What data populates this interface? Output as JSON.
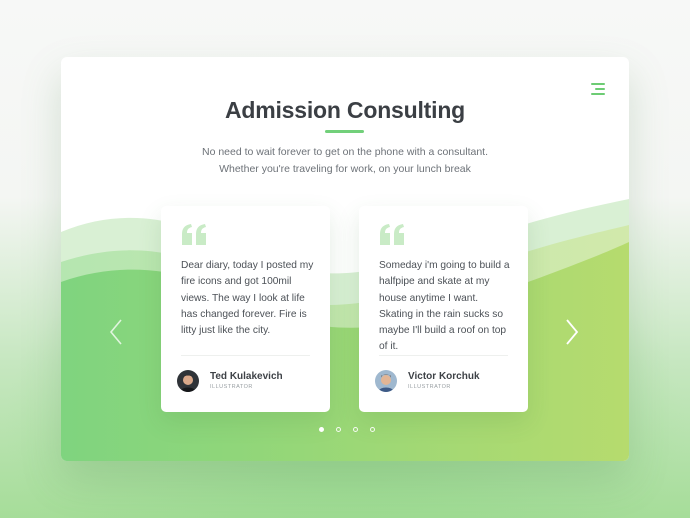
{
  "header": {
    "title": "Admission Consulting",
    "subtitle_line1": "No need to wait forever to get on the phone with a consultant.",
    "subtitle_line2": "Whether you're traveling for work, on your lunch break"
  },
  "menu": {
    "icon": "menu-icon"
  },
  "testimonials": [
    {
      "text": "Dear diary, today I posted my fire icons and got 100mil views. The way I look at life has changed forever. Fire is litty just like the city.",
      "name": "Ted Kulakevich",
      "role": "ILLUSTRATOR"
    },
    {
      "text": "Someday i'm going to build a halfpipe and skate at my house anytime I want. Skating in the rain sucks so maybe I'll build a roof on top of it.",
      "name": "Victor Korchuk",
      "role": "ILLUSTRATOR"
    }
  ],
  "carousel": {
    "prev_icon": "chevron-left-icon",
    "next_icon": "chevron-right-icon",
    "total_slides": 4,
    "active_slide": 1
  },
  "colors": {
    "accent": "#6dcc74",
    "title": "#3b3f44",
    "quote": "#c9ebc6"
  }
}
